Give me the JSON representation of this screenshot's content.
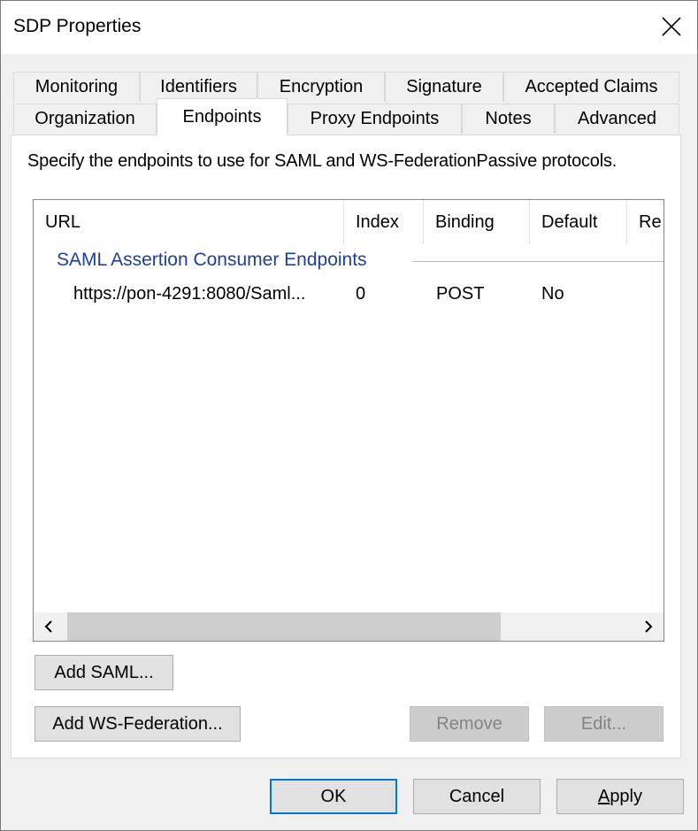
{
  "window": {
    "title": "SDP Properties"
  },
  "tabs_row1": [
    "Monitoring",
    "Identifiers",
    "Encryption",
    "Signature",
    "Accepted Claims"
  ],
  "tabs_row2": [
    "Organization",
    "Endpoints",
    "Proxy Endpoints",
    "Notes",
    "Advanced"
  ],
  "active_tab": "Endpoints",
  "description": "Specify the endpoints to use for SAML and WS-FederationPassive protocols.",
  "endpoints_list": {
    "columns": [
      "URL",
      "Index",
      "Binding",
      "Default",
      "Re"
    ],
    "group_label": "SAML Assertion Consumer Endpoints",
    "rows": [
      {
        "url": "https://pon-4291:8080/Saml...",
        "index": "0",
        "binding": "POST",
        "default": "No"
      }
    ]
  },
  "buttons": {
    "add_saml": "Add SAML...",
    "add_ws_federation": "Add WS-Federation...",
    "remove": "Remove",
    "edit": "Edit...",
    "ok": "OK",
    "cancel": "Cancel",
    "apply_prefix": "A",
    "apply_rest": "pply"
  },
  "icons": {
    "close": "close-icon",
    "scroll_left": "chevron-left-icon",
    "scroll_right": "chevron-right-icon"
  },
  "colors": {
    "group_label": "#1e3f9e",
    "default_button_border": "#0078d7"
  }
}
